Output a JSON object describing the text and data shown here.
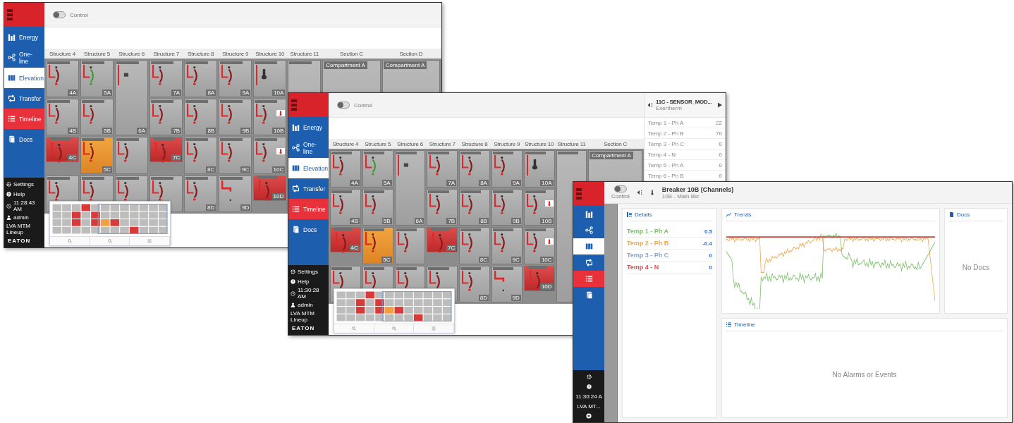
{
  "windows": [
    {
      "kind": "elevation",
      "sidebar": {
        "nav": [
          {
            "label": "Energy",
            "kind": "energy",
            "selected": false,
            "alert": false
          },
          {
            "label": "One-line",
            "kind": "oneline",
            "selected": false,
            "alert": false
          },
          {
            "label": "Elevation",
            "kind": "elevation",
            "selected": true,
            "alert": false
          },
          {
            "label": "Transfer",
            "kind": "transfer",
            "selected": false,
            "alert": false
          },
          {
            "label": "Timeline",
            "kind": "timeline",
            "selected": false,
            "alert": true
          },
          {
            "label": "Docs",
            "kind": "docs",
            "selected": false,
            "alert": false
          }
        ],
        "footer": [
          {
            "kind": "settings",
            "label": "Settings"
          },
          {
            "kind": "help",
            "label": "Help"
          },
          {
            "kind": "clock",
            "label": "11:28:43 AM"
          },
          {
            "kind": "user",
            "label": "admin"
          },
          {
            "kind": "site",
            "label": "LVA MTM Lineup"
          }
        ],
        "logo": "EATON"
      },
      "control": {
        "label": "Control",
        "on": false
      },
      "columns": [
        {
          "header": "Structure 4",
          "kind": "structure",
          "cells": [
            {
              "kind": "breaker",
              "alarm": false,
              "warning": false,
              "label": "4A"
            },
            {
              "kind": "breaker",
              "alarm": false,
              "warning": false,
              "label": "4B"
            },
            {
              "kind": "breaker",
              "alarm": true,
              "warning": false,
              "label": "4C"
            },
            {
              "kind": "breaker"
            }
          ]
        },
        {
          "header": "Structure 5",
          "kind": "structure",
          "cells": [
            {
              "kind": "breaker-closed",
              "alarm": false,
              "warning": false,
              "label": "5A"
            },
            {
              "kind": "breaker",
              "alarm": false,
              "warning": false,
              "label": "5B"
            },
            {
              "kind": "breaker",
              "alarm": false,
              "warning": true,
              "label": "5C"
            },
            {
              "kind": "breaker"
            }
          ]
        },
        {
          "header": "Structure 6",
          "kind": "structure",
          "cells": [
            {
              "kind": "transfer",
              "alarm": false,
              "warning": false,
              "label": "6A"
            },
            {
              "kind": "breaker"
            },
            {
              "kind": "breaker"
            }
          ]
        },
        {
          "header": "Structure 7",
          "kind": "structure",
          "cells": [
            {
              "kind": "breaker",
              "alarm": false,
              "warning": false,
              "label": "7A"
            },
            {
              "kind": "breaker",
              "alarm": false,
              "warning": false,
              "label": "7B"
            },
            {
              "kind": "breaker",
              "alarm": true,
              "warning": false,
              "label": "7C"
            },
            {
              "kind": "breaker"
            }
          ]
        },
        {
          "header": "Structure 8",
          "kind": "structure",
          "cells": [
            {
              "kind": "breaker",
              "alarm": false,
              "warning": false,
              "label": "8A"
            },
            {
              "kind": "breaker",
              "alarm": false,
              "warning": false,
              "label": "8B"
            },
            {
              "kind": "breaker",
              "alarm": false,
              "warning": false,
              "label": "8C"
            },
            {
              "kind": "breaker",
              "alarm": false,
              "warning": false,
              "label": "8D"
            }
          ]
        },
        {
          "header": "Structure 9",
          "kind": "structure",
          "cells": [
            {
              "kind": "breaker",
              "alarm": false,
              "warning": false,
              "label": "9A"
            },
            {
              "kind": "breaker",
              "alarm": false,
              "warning": false,
              "label": "9B"
            },
            {
              "kind": "breaker",
              "alarm": false,
              "warning": false,
              "label": "9C"
            },
            {
              "kind": "empty",
              "alarm": false,
              "warning": false,
              "label": "9D"
            }
          ]
        },
        {
          "header": "Structure 10",
          "kind": "structure",
          "cells": [
            {
              "kind": "sensor",
              "alarm": false,
              "warning": false,
              "label": "10A"
            },
            {
              "kind": "breaker",
              "alarm": false,
              "warning": false,
              "label": "10B",
              "callout": true
            },
            {
              "kind": "breaker",
              "alarm": false,
              "warning": false,
              "label": "10C",
              "callout": true
            },
            {
              "kind": "breaker",
              "alarm": true,
              "warning": false,
              "label": "10D"
            }
          ]
        },
        {
          "header": "Structure 11",
          "kind": "structure",
          "cells": [
            {
              "kind": "compartment"
            }
          ]
        },
        {
          "header": "Section C",
          "kind": "section",
          "cells": [
            {
              "kind": "compartment",
              "title": "Compartment A"
            }
          ]
        },
        {
          "header": "Section D",
          "kind": "section",
          "cells": [
            {
              "kind": "compartment",
              "title": "Compartment A"
            }
          ]
        }
      ]
    },
    {
      "kind": "elevation",
      "sidebar": {
        "nav": [
          {
            "label": "Energy",
            "kind": "energy",
            "selected": false,
            "alert": false
          },
          {
            "label": "One-line",
            "kind": "oneline",
            "selected": false,
            "alert": false
          },
          {
            "label": "Elevation",
            "kind": "elevation",
            "selected": true,
            "alert": false
          },
          {
            "label": "Transfer",
            "kind": "transfer",
            "selected": false,
            "alert": false
          },
          {
            "label": "Timeline",
            "kind": "timeline",
            "selected": false,
            "alert": true
          },
          {
            "label": "Docs",
            "kind": "docs",
            "selected": false,
            "alert": false
          }
        ],
        "footer": [
          {
            "kind": "settings",
            "label": "Settings"
          },
          {
            "kind": "help",
            "label": "Help"
          },
          {
            "kind": "clock",
            "label": "11:30:28 AM"
          },
          {
            "kind": "user",
            "label": "admin"
          },
          {
            "kind": "site",
            "label": "LVA MTM Lineup"
          }
        ],
        "logo": "EATON"
      },
      "control": {
        "label": "Control",
        "on": false
      },
      "columns": [
        {
          "header": "Structure 4",
          "kind": "structure",
          "cells": [
            {
              "kind": "breaker",
              "alarm": false,
              "warning": false,
              "label": "4A"
            },
            {
              "kind": "breaker",
              "alarm": false,
              "warning": false,
              "label": "4B"
            },
            {
              "kind": "breaker",
              "alarm": true,
              "warning": false,
              "label": "4C"
            },
            {
              "kind": "breaker"
            }
          ]
        },
        {
          "header": "Structure 5",
          "kind": "structure",
          "cells": [
            {
              "kind": "breaker-closed",
              "alarm": false,
              "warning": false,
              "label": "5A"
            },
            {
              "kind": "breaker",
              "alarm": false,
              "warning": false,
              "label": "5B"
            },
            {
              "kind": "breaker",
              "alarm": false,
              "warning": true,
              "label": "5C"
            },
            {
              "kind": "breaker"
            }
          ]
        },
        {
          "header": "Structure 6",
          "kind": "structure",
          "cells": [
            {
              "kind": "transfer",
              "alarm": false,
              "warning": false,
              "label": "6A"
            },
            {
              "kind": "breaker"
            },
            {
              "kind": "breaker"
            }
          ]
        },
        {
          "header": "Structure 7",
          "kind": "structure",
          "cells": [
            {
              "kind": "breaker",
              "alarm": false,
              "warning": false,
              "label": "7A"
            },
            {
              "kind": "breaker",
              "alarm": false,
              "warning": false,
              "label": "7B"
            },
            {
              "kind": "breaker",
              "alarm": true,
              "warning": false,
              "label": "7C"
            },
            {
              "kind": "breaker"
            }
          ]
        },
        {
          "header": "Structure 8",
          "kind": "structure",
          "cells": [
            {
              "kind": "breaker",
              "alarm": false,
              "warning": false,
              "label": "8A"
            },
            {
              "kind": "breaker",
              "alarm": false,
              "warning": false,
              "label": "8B"
            },
            {
              "kind": "breaker",
              "alarm": false,
              "warning": false,
              "label": "8C"
            },
            {
              "kind": "breaker",
              "alarm": false,
              "warning": false,
              "label": "8D"
            }
          ]
        },
        {
          "header": "Structure 9",
          "kind": "structure",
          "cells": [
            {
              "kind": "breaker",
              "alarm": false,
              "warning": false,
              "label": "9A"
            },
            {
              "kind": "breaker",
              "alarm": false,
              "warning": false,
              "label": "9B"
            },
            {
              "kind": "breaker",
              "alarm": false,
              "warning": false,
              "label": "9C"
            },
            {
              "kind": "empty",
              "alarm": false,
              "warning": false,
              "label": "9D"
            }
          ]
        },
        {
          "header": "Structure 10",
          "kind": "structure",
          "cells": [
            {
              "kind": "sensor",
              "alarm": false,
              "warning": false,
              "label": "10A"
            },
            {
              "kind": "breaker",
              "alarm": false,
              "warning": false,
              "label": "10B",
              "callout": true
            },
            {
              "kind": "breaker",
              "alarm": false,
              "warning": false,
              "label": "10C",
              "callout": true
            },
            {
              "kind": "breaker",
              "alarm": true,
              "warning": false,
              "label": "10D"
            }
          ]
        },
        {
          "header": "Structure 11",
          "kind": "structure",
          "cells": [
            {
              "kind": "compartment"
            }
          ]
        },
        {
          "header": "Section C",
          "kind": "section",
          "cells": [
            {
              "kind": "compartment",
              "title": "Compartment A"
            }
          ]
        }
      ],
      "panel": {
        "title": "11C - SENSOR_MOD...",
        "subtitle": "Exertherm",
        "rows": [
          {
            "label": "Temp 1 - Ph A",
            "value": "22"
          },
          {
            "label": "Temp 2 - Ph B",
            "value": "70"
          },
          {
            "label": "Temp 3 - Ph C",
            "value": "0"
          },
          {
            "label": "Temp 4 - N",
            "value": "0"
          },
          {
            "label": "Temp 5 - Ph A",
            "value": "0"
          },
          {
            "label": "Temp 6 - Ph B",
            "value": "0"
          }
        ]
      }
    },
    {
      "kind": "detail",
      "sidebar": {
        "nav": [
          {
            "kind": "energy",
            "selected": false,
            "alert": false
          },
          {
            "kind": "oneline",
            "selected": false,
            "alert": false
          },
          {
            "kind": "elevation",
            "selected": true,
            "alert": false
          },
          {
            "kind": "transfer",
            "selected": false,
            "alert": false
          },
          {
            "kind": "timeline",
            "selected": false,
            "alert": true
          },
          {
            "kind": "docs",
            "selected": false,
            "alert": false
          }
        ],
        "footer": [
          {
            "kind": "settings"
          },
          {
            "kind": "help"
          },
          {
            "kind": "clock-text",
            "label": "11:30:24 A"
          },
          {
            "kind": "site",
            "label": "LVA MT..."
          }
        ]
      },
      "control": {
        "label": "Control",
        "on": false
      },
      "title": "Breaker 10B (Channels)",
      "subtitle": "10B - Main Bkr",
      "details": {
        "title": "Details",
        "rows": [
          {
            "label": "Temp 1 - Ph A",
            "value": "0.5",
            "color": "#7cc06a"
          },
          {
            "label": "Temp 2 - Ph B",
            "value": "-0.4",
            "color": "#f0a850"
          },
          {
            "label": "Temp 3 - Ph C",
            "value": "0",
            "color": "#8fa6c8"
          },
          {
            "label": "Temp 4 - N",
            "value": "0",
            "color": "#d9534f"
          }
        ]
      },
      "trends": {
        "title": "Trends"
      },
      "docs": {
        "title": "Docs",
        "empty": "No Docs"
      },
      "timeline": {
        "title": "Timeline",
        "empty": "No Alarms or Events"
      }
    }
  ]
}
